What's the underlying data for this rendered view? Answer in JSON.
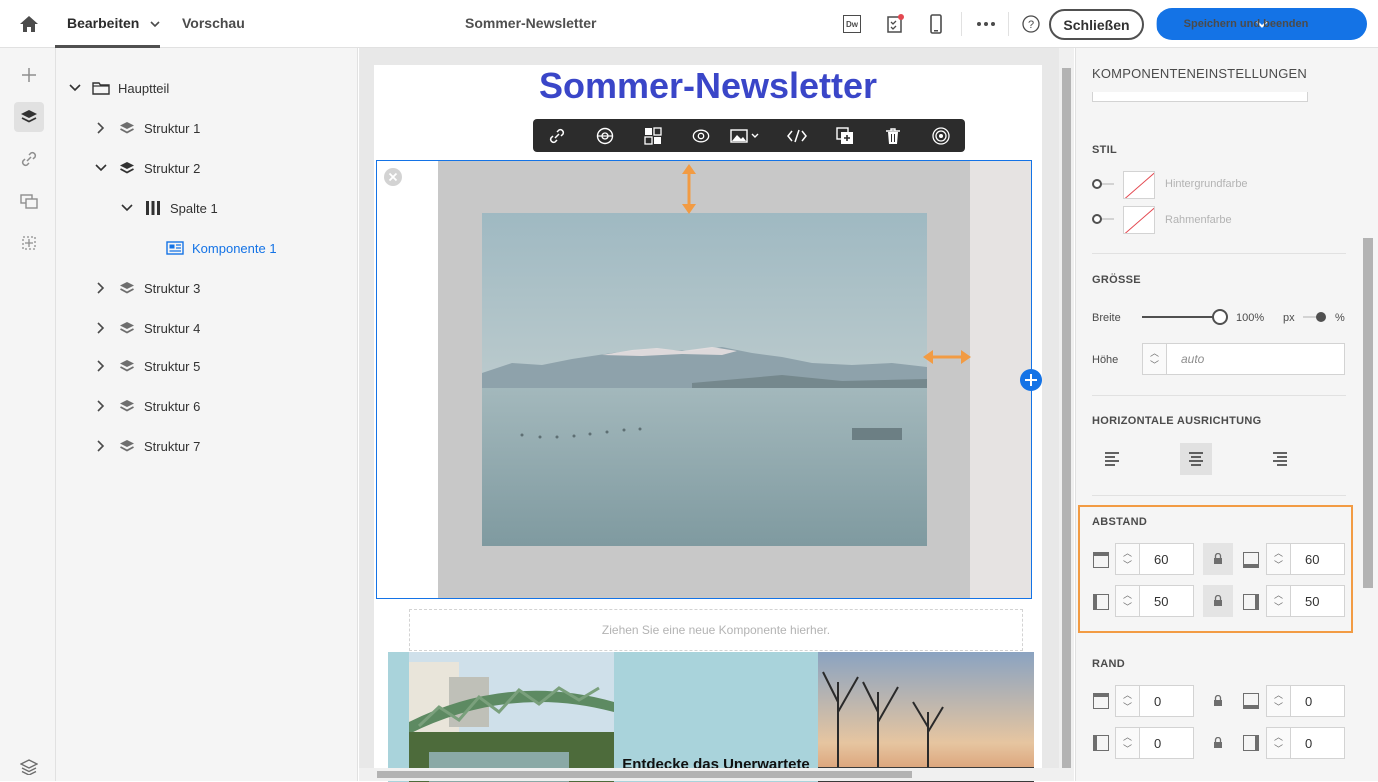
{
  "header": {
    "home_icon": "home-icon",
    "tabs": [
      {
        "label": "Bearbeiten"
      },
      {
        "label": "Vorschau"
      }
    ],
    "title": "Sommer-Newsletter",
    "dw_label": "Dw",
    "close_label": "Schließen",
    "save_label": "Speichern und beenden",
    "accent": "#1473e6"
  },
  "tree": {
    "nodes": [
      {
        "label": "Hauptteil"
      },
      {
        "label": "Struktur 1"
      },
      {
        "label": "Struktur 2"
      },
      {
        "label": "Spalte 1"
      },
      {
        "label": "Komponente 1"
      },
      {
        "label": "Struktur 3"
      },
      {
        "label": "Struktur 4"
      },
      {
        "label": "Struktur 5"
      },
      {
        "label": "Struktur 6"
      },
      {
        "label": "Struktur 7"
      }
    ]
  },
  "canvas": {
    "newsletter_title": "Sommer-Newsletter",
    "title_color": "#3a46c8",
    "dropzone_text": "Ziehen Sie eine neue Komponente hierher.",
    "caption": "Entdecke das Unerwartete"
  },
  "panel": {
    "title": "KOMPONENTENEINSTELLUNGEN",
    "stil": {
      "heading": "STIL",
      "background_label": "Hintergrundfarbe",
      "border_label": "Rahmenfarbe"
    },
    "groesse": {
      "heading": "GRÖSSE",
      "width_label": "Breite",
      "width_value": "100%",
      "width_fraction": 1.0,
      "unit_px": "px",
      "unit_pct": "%",
      "height_label": "Höhe",
      "height_placeholder": "auto"
    },
    "ausrichtung": {
      "heading": "HORIZONTALE AUSRICHTUNG",
      "selected": "center"
    },
    "abstand": {
      "heading": "ABSTAND",
      "top": "60",
      "bottom": "60",
      "left": "50",
      "right": "50"
    },
    "rand": {
      "heading": "RAND",
      "top": "0",
      "bottom": "0",
      "left": "0",
      "right": "0"
    },
    "highlight_color": "#f29b43"
  }
}
